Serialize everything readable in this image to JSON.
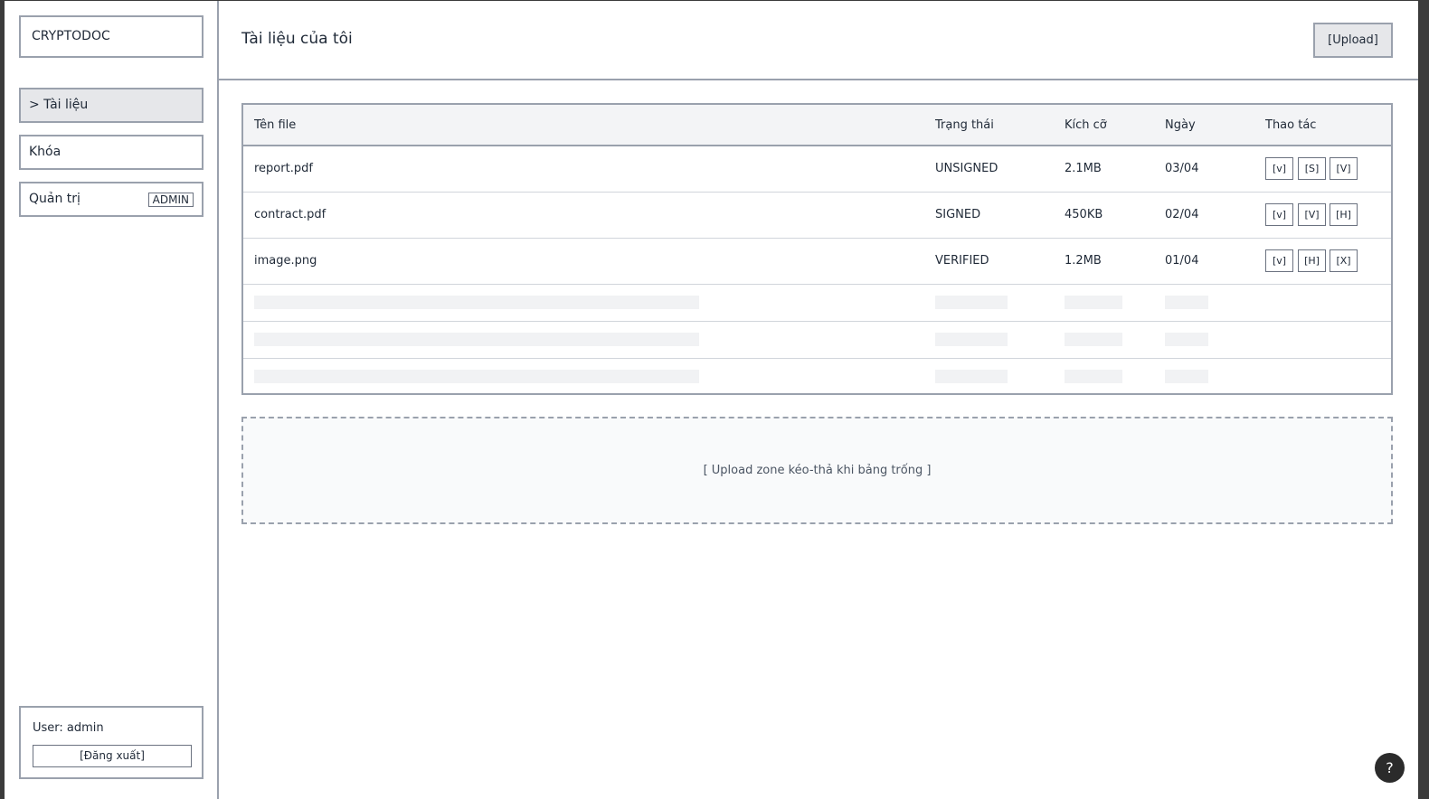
{
  "sidebar": {
    "brand": "CRYPTODOC",
    "items": [
      {
        "label": "> Tài liệu"
      },
      {
        "label": "Khóa"
      },
      {
        "label": "Quản trị",
        "badge": "ADMIN"
      }
    ],
    "user_label": "User: admin",
    "logout_label": "[Đăng xuất]"
  },
  "header": {
    "title": "Tài liệu của tôi",
    "upload_label": "[Upload]"
  },
  "table": {
    "columns": [
      "Tên file",
      "Trạng thái",
      "Kích cỡ",
      "Ngày",
      "Thao tác"
    ],
    "rows": [
      {
        "name": "report.pdf",
        "status": "UNSIGNED",
        "size": "2.1MB",
        "date": "03/04",
        "actions": [
          "[v]",
          "[S]",
          "[V]"
        ]
      },
      {
        "name": "contract.pdf",
        "status": "SIGNED",
        "size": "450KB",
        "date": "02/04",
        "actions": [
          "[v]",
          "[V]",
          "[H]"
        ]
      },
      {
        "name": "image.png",
        "status": "VERIFIED",
        "size": "1.2MB",
        "date": "01/04",
        "actions": [
          "[v]",
          "[H]",
          "[X]"
        ]
      }
    ]
  },
  "dropzone": {
    "label": "[ Upload zone kéo-thả khi bảng trống ]"
  },
  "help": {
    "label": "?"
  }
}
